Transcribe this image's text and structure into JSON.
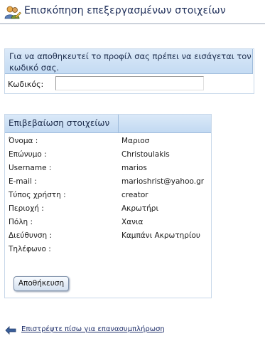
{
  "header": {
    "title": "Επισκόπηση επεξεργασμένων στοιχείων"
  },
  "password_section": {
    "message": "Για να αποθηκευτεί το προφίλ σας πρέπει να εισάγεται τον κωδικό σας.",
    "label": "Κωδικός:",
    "value": ""
  },
  "details": {
    "heading": "Επιβεβαίωση στοιχείων",
    "rows": [
      {
        "label": "Όνομα :",
        "value": "Μαριοσ"
      },
      {
        "label": "Επώνυμο :",
        "value": "Christoulakis"
      },
      {
        "label": "Username :",
        "value": "marios"
      },
      {
        "label": "E-mail :",
        "value": "marioshrist@yahoo.gr"
      },
      {
        "label": "Τύπος χρήστη :",
        "value": "creator"
      },
      {
        "label": "Περιοχή :",
        "value": "Ακρωτήρι"
      },
      {
        "label": "Πόλη :",
        "value": "Χανια"
      },
      {
        "label": "Διεύθυνση :",
        "value": "Καμπάνι Ακρωτηρίου"
      },
      {
        "label": "Τηλέφωνο :",
        "value": ""
      }
    ],
    "save_label": "Αποθήκευση"
  },
  "back_link": {
    "text": "Επιστρέψτε πίσω για επανασυμπλήρωση"
  }
}
